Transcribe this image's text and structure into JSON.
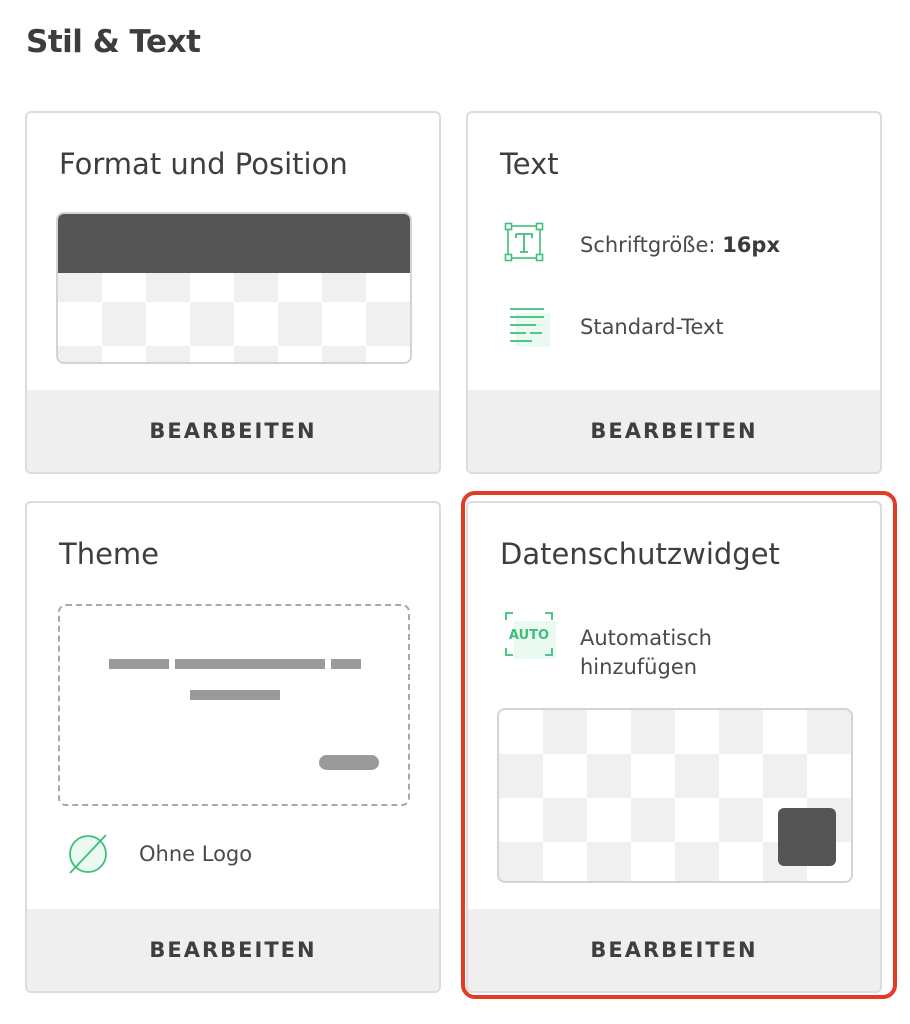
{
  "section": {
    "title": "Stil & Text"
  },
  "cards": {
    "format": {
      "title": "Format und Position",
      "button": "BEARBEITEN"
    },
    "text": {
      "title": "Text",
      "font_size_label": "Schriftgröße:",
      "font_size_value": "16px",
      "text_style": "Standard-Text",
      "button": "BEARBEITEN"
    },
    "theme": {
      "title": "Theme",
      "logo_label": "Ohne Logo",
      "button": "BEARBEITEN"
    },
    "privacy": {
      "title": "Datenschutzwidget",
      "auto_badge": "AUTO",
      "auto_line1": "Automatisch",
      "auto_line2": "hinzufügen",
      "button": "BEARBEITEN"
    }
  },
  "colors": {
    "accent": "#3dbf7b",
    "highlight": "#e23b26",
    "dark_fill": "#555555"
  },
  "icons": [
    "text-size-icon",
    "text-lines-icon",
    "no-logo-icon",
    "auto-icon"
  ]
}
